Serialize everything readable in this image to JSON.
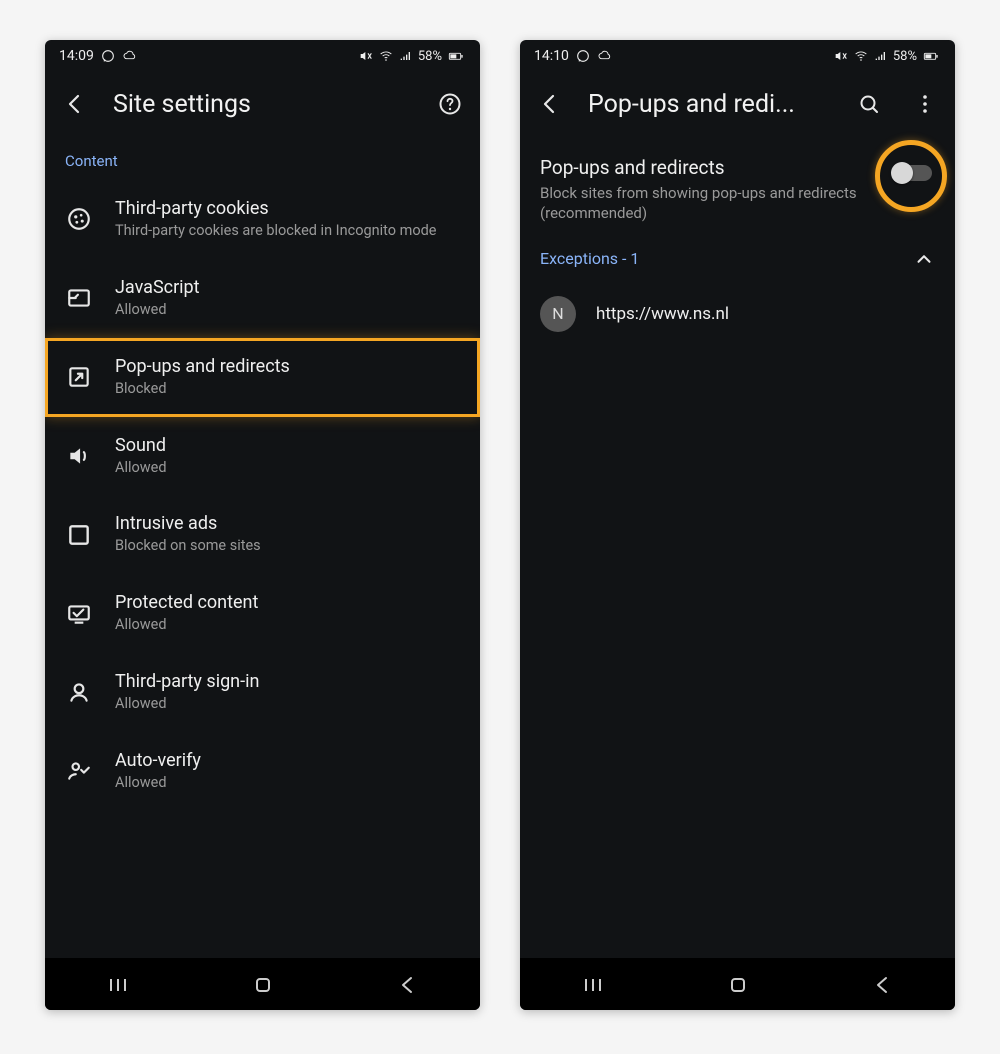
{
  "left": {
    "status": {
      "time": "14:09",
      "battery": "58%"
    },
    "title": "Site settings",
    "section": "Content",
    "items": [
      {
        "icon": "cookie-icon",
        "title": "Third-party cookies",
        "sub": "Third-party cookies are blocked in Incognito mode"
      },
      {
        "icon": "js-icon",
        "title": "JavaScript",
        "sub": "Allowed"
      },
      {
        "icon": "popup-icon",
        "title": "Pop-ups and redirects",
        "sub": "Blocked",
        "highlight": true
      },
      {
        "icon": "sound-icon",
        "title": "Sound",
        "sub": "Allowed"
      },
      {
        "icon": "ads-icon",
        "title": "Intrusive ads",
        "sub": "Blocked on some sites"
      },
      {
        "icon": "protected-icon",
        "title": "Protected content",
        "sub": "Allowed"
      },
      {
        "icon": "signin-icon",
        "title": "Third-party sign-in",
        "sub": "Allowed"
      },
      {
        "icon": "verify-icon",
        "title": "Auto-verify",
        "sub": "Allowed"
      }
    ]
  },
  "right": {
    "status": {
      "time": "14:10",
      "battery": "58%"
    },
    "title": "Pop-ups and redi...",
    "popup": {
      "title": "Pop-ups and redirects",
      "sub": "Block sites from showing pop-ups and redirects (recommended)"
    },
    "exceptions_label": "Exceptions - 1",
    "exceptions": [
      {
        "badge": "N",
        "url": "https://www.ns.nl"
      }
    ]
  }
}
